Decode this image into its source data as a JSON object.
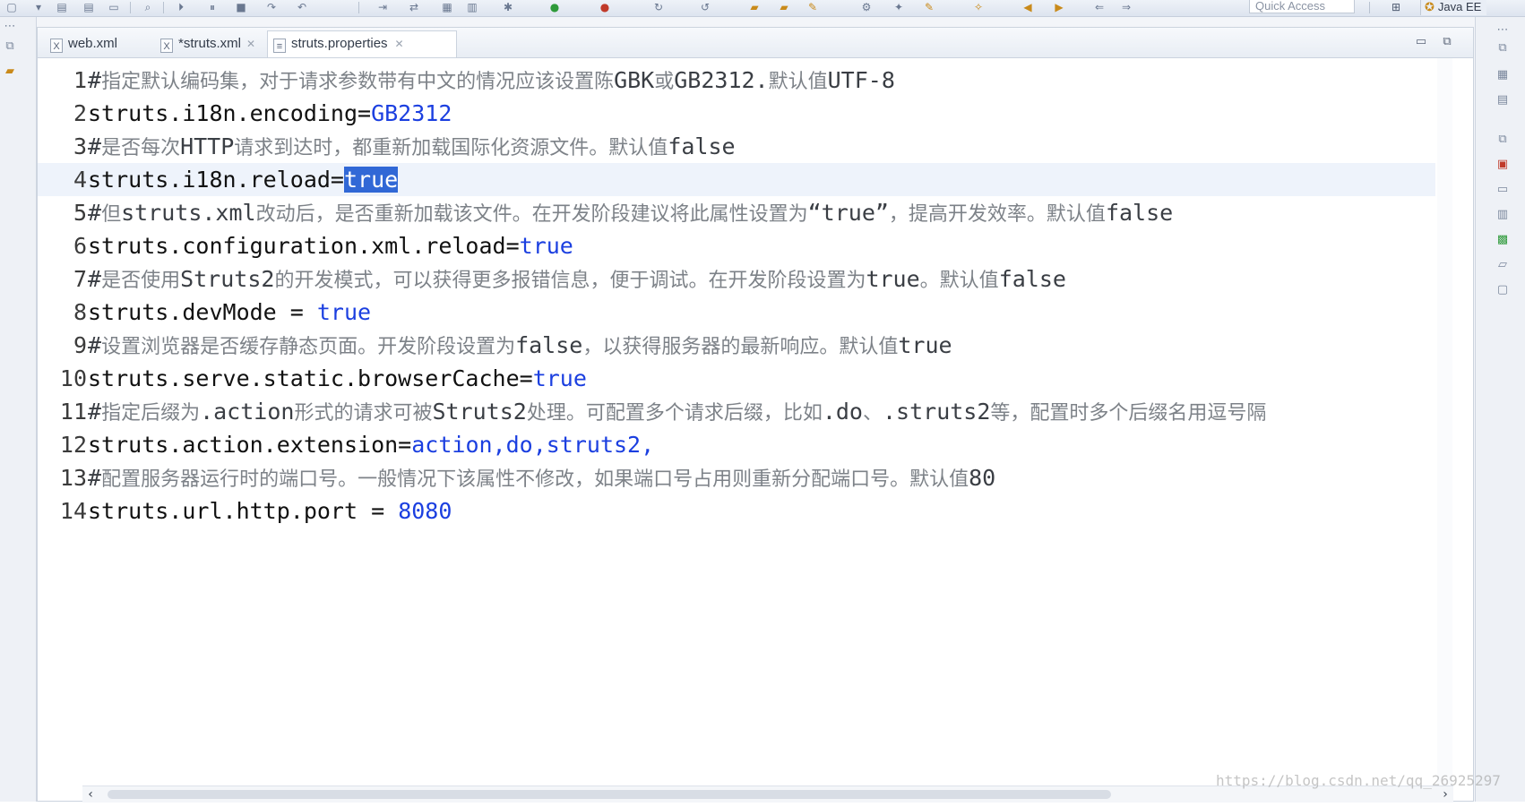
{
  "toolbar": {
    "quick_access_placeholder": "Quick Access",
    "perspective_label": "Java EE",
    "perspective_icon": "java-ee-icon",
    "open_perspective_icon": "open-perspective-icon"
  },
  "tabs": [
    {
      "label": "web.xml",
      "icon": "xml-file-icon",
      "active": false,
      "dirty": false
    },
    {
      "label": "*struts.xml",
      "icon": "xml-file-icon",
      "active": false,
      "dirty": true
    },
    {
      "label": "struts.properties",
      "icon": "properties-file-icon",
      "active": true,
      "dirty": false
    }
  ],
  "editor": {
    "current_line": 4,
    "lines": [
      {
        "n": "1",
        "type": "comment",
        "parts": [
          {
            "t": "#",
            "k": "lat"
          },
          {
            "t": "指定默认编码集，对于请求参数带有中文的情况应该设置陈",
            "k": "cjk"
          },
          {
            "t": "GBK",
            "k": "lat"
          },
          {
            "t": "或",
            "k": "cjk"
          },
          {
            "t": "GB2312.",
            "k": "lat"
          },
          {
            "t": "默认值",
            "k": "cjk"
          },
          {
            "t": "UTF-8",
            "k": "lat"
          }
        ]
      },
      {
        "n": "2",
        "type": "prop",
        "key": "struts.i18n.encoding=",
        "value": "GB2312"
      },
      {
        "n": "3",
        "type": "comment",
        "parts": [
          {
            "t": "#",
            "k": "lat"
          },
          {
            "t": "是否每次",
            "k": "cjk"
          },
          {
            "t": "HTTP",
            "k": "lat"
          },
          {
            "t": "请求到达时，都重新加载国际化资源文件。默认值",
            "k": "cjk"
          },
          {
            "t": "false",
            "k": "lat"
          }
        ]
      },
      {
        "n": "4",
        "type": "prop",
        "key": "struts.i18n.reload=",
        "value": "true",
        "selected": true
      },
      {
        "n": "5",
        "type": "comment",
        "parts": [
          {
            "t": "#",
            "k": "lat"
          },
          {
            "t": "但",
            "k": "cjk"
          },
          {
            "t": "struts.xml",
            "k": "lat"
          },
          {
            "t": "改动后，是否重新加载该文件。在开发阶段建议将此属性设置为",
            "k": "cjk"
          },
          {
            "t": "“true”",
            "k": "lat"
          },
          {
            "t": "，提高开发效率。默认值",
            "k": "cjk"
          },
          {
            "t": "false",
            "k": "lat"
          }
        ]
      },
      {
        "n": "6",
        "type": "prop",
        "key": "struts.configuration.xml.reload=",
        "value": "true"
      },
      {
        "n": "7",
        "type": "comment",
        "parts": [
          {
            "t": "#",
            "k": "lat"
          },
          {
            "t": "是否使用",
            "k": "cjk"
          },
          {
            "t": "Struts2",
            "k": "lat"
          },
          {
            "t": "的开发模式，可以获得更多报错信息，便于调试。在开发阶段设置为",
            "k": "cjk"
          },
          {
            "t": "true",
            "k": "lat"
          },
          {
            "t": "。默认值",
            "k": "cjk"
          },
          {
            "t": "false",
            "k": "lat"
          }
        ]
      },
      {
        "n": "8",
        "type": "prop",
        "key": "struts.devMode = ",
        "value": "true"
      },
      {
        "n": "9",
        "type": "comment",
        "parts": [
          {
            "t": "#",
            "k": "lat"
          },
          {
            "t": "设置浏览器是否缓存静态页面。开发阶段设置为",
            "k": "cjk"
          },
          {
            "t": "false",
            "k": "lat"
          },
          {
            "t": "，以获得服务器的最新响应。默认值",
            "k": "cjk"
          },
          {
            "t": "true",
            "k": "lat"
          }
        ]
      },
      {
        "n": "10",
        "type": "prop",
        "key": "struts.serve.static.browserCache=",
        "value": "true"
      },
      {
        "n": "11",
        "type": "comment",
        "parts": [
          {
            "t": "#",
            "k": "lat"
          },
          {
            "t": "指定后缀为",
            "k": "cjk"
          },
          {
            "t": ".action",
            "k": "lat"
          },
          {
            "t": "形式的请求可被",
            "k": "cjk"
          },
          {
            "t": "Struts2",
            "k": "lat"
          },
          {
            "t": "处理。可配置多个请求后缀，比如",
            "k": "cjk"
          },
          {
            "t": ".do",
            "k": "lat"
          },
          {
            "t": "、",
            "k": "cjk"
          },
          {
            "t": ".struts2",
            "k": "lat"
          },
          {
            "t": "等，配置时多个后缀名用逗号隔",
            "k": "cjk"
          }
        ]
      },
      {
        "n": "12",
        "type": "prop",
        "key": "struts.action.extension=",
        "value": "action,do,struts2,"
      },
      {
        "n": "13",
        "type": "comment",
        "parts": [
          {
            "t": "#",
            "k": "lat"
          },
          {
            "t": "配置服务器运行时的端口号。一般情况下该属性不修改，如果端口号占用则重新分配端口号。默认值",
            "k": "cjk"
          },
          {
            "t": "80",
            "k": "lat"
          }
        ]
      },
      {
        "n": "14",
        "type": "prop",
        "key": "struts.url.http.port = ",
        "value": "8080"
      }
    ]
  },
  "scrollbar": {
    "left_arrow": "‹",
    "right_arrow": "›"
  },
  "watermark": "https://blog.csdn.net/qq_26925297",
  "colors": {
    "value_blue": "#1b3fe0",
    "selection": "#3168d6",
    "comment_cjk": "#7d8288"
  }
}
